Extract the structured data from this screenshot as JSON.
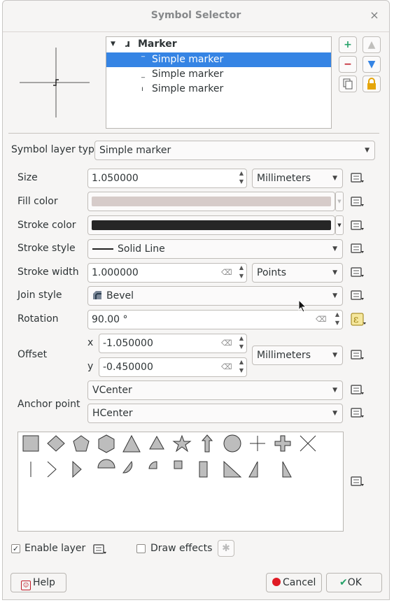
{
  "window": {
    "title": "Symbol Selector",
    "close": "×"
  },
  "tree": {
    "root": {
      "label": "Marker",
      "arrow": "▼",
      "icon": "ɹ"
    },
    "items": [
      {
        "label": "Simple marker",
        "mini": "‾",
        "selected": true
      },
      {
        "label": "Simple marker",
        "mini": "_",
        "selected": false
      },
      {
        "label": "Simple marker",
        "mini": "ı",
        "selected": false
      }
    ]
  },
  "toolbar": {
    "add": "+",
    "remove": "−",
    "duplicate": "copy",
    "up": "▲",
    "down": "▼",
    "lock": "lock"
  },
  "symbol_layer_type": {
    "label": "Symbol layer type",
    "value": "Simple marker"
  },
  "props": {
    "size": {
      "label": "Size",
      "value": "1.050000",
      "unit": "Millimeters"
    },
    "fill_color": {
      "label": "Fill color",
      "color": "#d6cbc9"
    },
    "stroke_color": {
      "label": "Stroke color",
      "color": "#262626"
    },
    "stroke_style": {
      "label": "Stroke style",
      "value": "Solid Line"
    },
    "stroke_width": {
      "label": "Stroke width",
      "value": "1.000000",
      "unit": "Points"
    },
    "join_style": {
      "label": "Join style",
      "value": "Bevel"
    },
    "rotation": {
      "label": "Rotation",
      "value": "90.00 °"
    },
    "offset": {
      "label": "Offset",
      "x_label": "x",
      "x_value": "-1.050000",
      "y_label": "y",
      "y_value": "-0.450000",
      "unit": "Millimeters"
    },
    "anchor": {
      "label": "Anchor point",
      "vertical": "VCenter",
      "horizontal": "HCenter"
    }
  },
  "shapes": [
    "square",
    "diamond",
    "pentagon",
    "hexagon",
    "triangle",
    "equilateral-triangle",
    "star",
    "arrow",
    "circle",
    "cross",
    "cross-fill",
    "x",
    "line",
    "arrowhead",
    "filled-arrowhead",
    "semicircle",
    "quarter-circle",
    "third-circle",
    "small-square",
    "rectangle",
    "right-half-triangle",
    "half-triangle",
    "left-half-triangle"
  ],
  "footer": {
    "enable_layer": "Enable layer",
    "enable_checked": true,
    "draw_effects": "Draw effects",
    "draw_effects_checked": false,
    "help": "Help",
    "cancel": "Cancel",
    "ok": "OK"
  },
  "colors": {
    "selection": "#3584e4",
    "expression_active": "#f5e79e"
  }
}
